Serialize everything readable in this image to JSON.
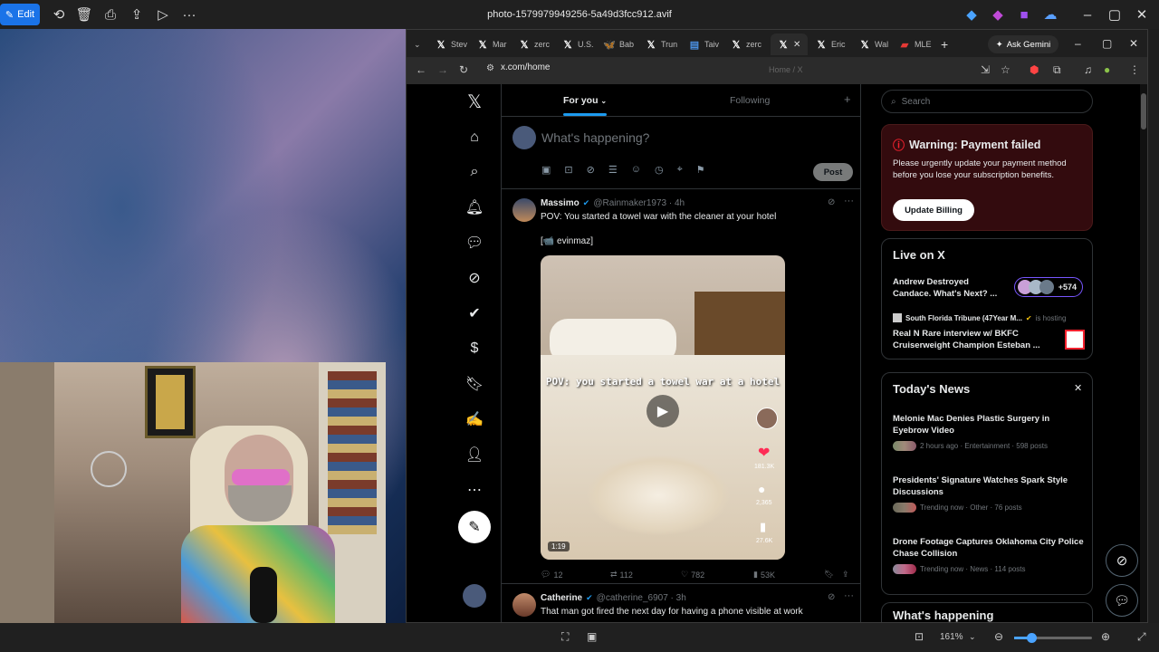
{
  "viewer": {
    "edit_label": "Edit",
    "file_title": "photo-1579979949256-5a49d3fcc912.avif",
    "zoom": "161%"
  },
  "browser": {
    "tabs": [
      {
        "icon": "x-logo-icon",
        "label": "Stev"
      },
      {
        "icon": "x-logo-icon",
        "label": "Mar"
      },
      {
        "icon": "x-logo-icon",
        "label": "zerc"
      },
      {
        "icon": "x-logo-icon",
        "label": "U.S."
      },
      {
        "icon": "butterfly-icon",
        "label": "Bab"
      },
      {
        "icon": "x-logo-icon",
        "label": "Trun"
      },
      {
        "icon": "chart-icon",
        "label": "Taiv"
      },
      {
        "icon": "x-logo-icon",
        "label": "zerc"
      },
      {
        "icon": "x-logo-icon",
        "label": ""
      },
      {
        "icon": "x-logo-icon",
        "label": "Eric"
      },
      {
        "icon": "x-logo-icon",
        "label": "Wal"
      },
      {
        "icon": "flag-icon",
        "label": "MLE"
      }
    ],
    "ask_gemini": "Ask Gemini",
    "url": "x.com/home",
    "tooltip": "Home / X"
  },
  "feed": {
    "tab_for_you": "For you",
    "tab_following": "Following",
    "compose_placeholder": "What's happening?",
    "post_button": "Post",
    "tweets": [
      {
        "name": "Massimo",
        "handle": "@Rainmaker1973 · 4h",
        "text": "POV: You started a towel war with the cleaner at your hotel",
        "credit": "[📹 evinmaz]",
        "video_caption": "POV: you started a towel war at a hotel",
        "video_time": "1:19",
        "likes_overlay": "181.3K",
        "comments_overlay": "2,365",
        "saves_overlay": "27.6K",
        "replies": "12",
        "reposts": "112",
        "likes": "782",
        "views": "53K"
      },
      {
        "name": "Catherine",
        "handle": "@catherine_6907 · 3h",
        "text": "That man got fired the next day for having a phone visible at work"
      }
    ]
  },
  "sidebar_right": {
    "search_placeholder": "Search",
    "warning_title": "Warning: Payment failed",
    "warning_body": "Please urgently update your payment method before you lose your subscription benefits.",
    "update_billing": "Update Billing",
    "live_title": "Live on X",
    "live_1": "Andrew Destroyed Candace. What's Next? ...",
    "live_count": "+574",
    "live_2_host": "South Florida Tribune (47Year M...",
    "live_2_hosting": "is hosting",
    "live_2_title": "Real N Rare interview w/ BKFC Cruiserweight Champion Esteban ...",
    "news_title": "Today's News",
    "news": [
      {
        "title": "Melonie Mac Denies Plastic Surgery in Eyebrow Video",
        "meta": "2 hours ago · Entertainment · 598 posts"
      },
      {
        "title": "Presidents' Signature Watches Spark Style Discussions",
        "meta": "Trending now · Other · 76 posts"
      },
      {
        "title": "Drone Footage Captures Oklahoma City Police Chase Collision",
        "meta": "Trending now · News · 114 posts"
      }
    ],
    "whats_happening": "What's happening"
  },
  "colors": {
    "x_blue": "#1d9bf0",
    "warning_red": "#f4212e",
    "warning_bg": "#330b0e",
    "viewer_blue": "#1a73e8"
  }
}
